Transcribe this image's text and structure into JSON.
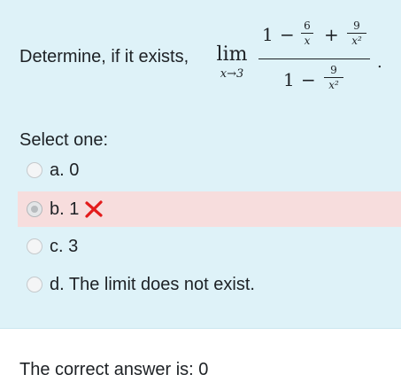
{
  "question": {
    "prompt": "Determine, if it exists,",
    "lim_word": "lim",
    "lim_sub": "x→3",
    "numerator": {
      "one": "1",
      "minus": "−",
      "frac1_num": "6",
      "frac1_den": "x",
      "plus": "+",
      "frac2_num": "9",
      "frac2_den": "x²"
    },
    "denominator": {
      "one": "1",
      "minus": "−",
      "frac_num": "9",
      "frac_den": "x²"
    },
    "period": "."
  },
  "select_label": "Select one:",
  "options": [
    {
      "text": "a. 0",
      "checked": false
    },
    {
      "text": "b. 1",
      "checked": true,
      "status": "incorrect"
    },
    {
      "text": "c. 3",
      "checked": false
    },
    {
      "text": "d. The limit does not exist.",
      "checked": false
    }
  ],
  "feedback": {
    "correct_answer": "The correct answer is: 0"
  },
  "colors": {
    "panel_bg": "#def2f8",
    "incorrect_bg": "#f7dddd",
    "incorrect_icon": "#e31b1b"
  },
  "icons": {
    "incorrect": "cross-icon"
  }
}
